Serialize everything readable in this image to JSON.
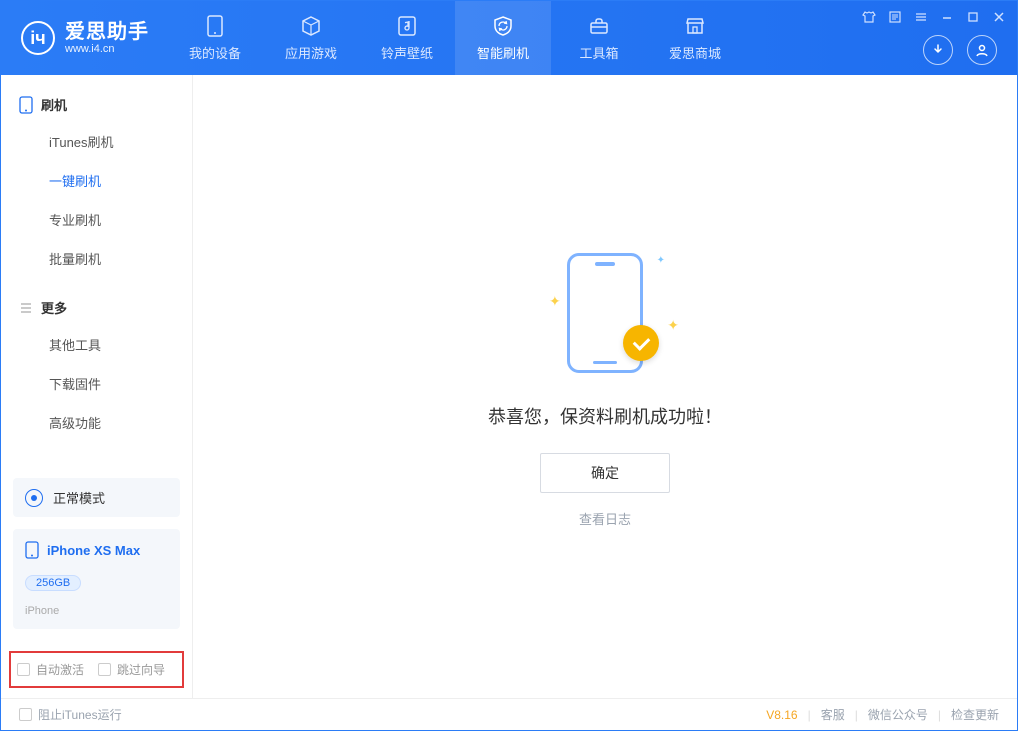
{
  "brand": {
    "name": "爱思助手",
    "url": "www.i4.cn"
  },
  "tabs": [
    {
      "id": "device",
      "label": "我的设备"
    },
    {
      "id": "apps",
      "label": "应用游戏"
    },
    {
      "id": "ring",
      "label": "铃声壁纸"
    },
    {
      "id": "flash",
      "label": "智能刷机"
    },
    {
      "id": "tools",
      "label": "工具箱"
    },
    {
      "id": "store",
      "label": "爱思商城"
    }
  ],
  "sidebar": {
    "group1": {
      "title": "刷机",
      "items": [
        {
          "label": "iTunes刷机"
        },
        {
          "label": "一键刷机"
        },
        {
          "label": "专业刷机"
        },
        {
          "label": "批量刷机"
        }
      ]
    },
    "group2": {
      "title": "更多",
      "items": [
        {
          "label": "其他工具"
        },
        {
          "label": "下载固件"
        },
        {
          "label": "高级功能"
        }
      ]
    },
    "mode_label": "正常模式",
    "device": {
      "name": "iPhone XS Max",
      "capacity": "256GB",
      "sub": "iPhone"
    },
    "opts": {
      "auto_activate": "自动激活",
      "skip_guide": "跳过向导"
    }
  },
  "content": {
    "msg": "恭喜您，保资料刷机成功啦！",
    "ok": "确定",
    "view_log": "查看日志"
  },
  "footer": {
    "block_itunes": "阻止iTunes运行",
    "version": "V8.16",
    "links": [
      "客服",
      "微信公众号",
      "检查更新"
    ]
  }
}
